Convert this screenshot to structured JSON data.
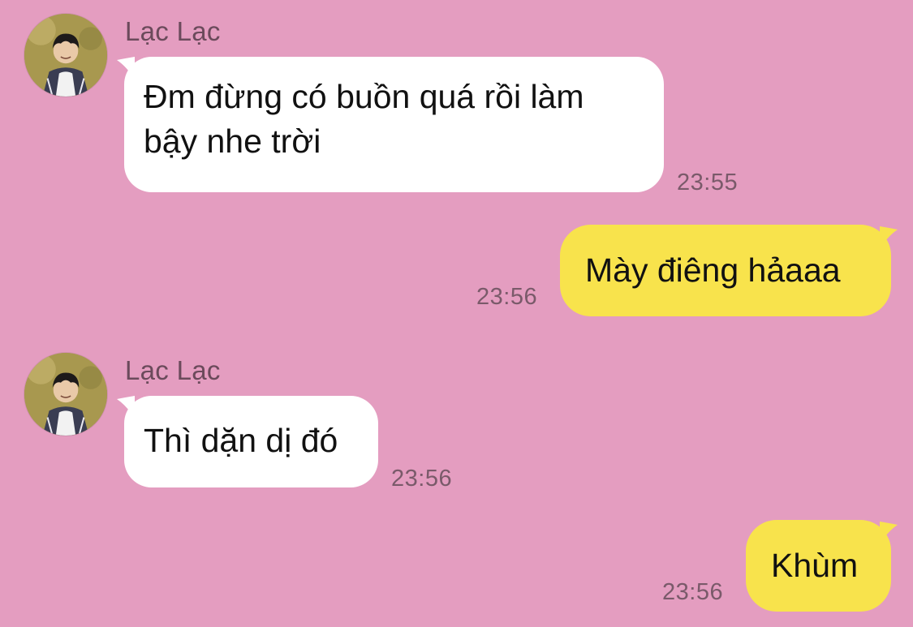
{
  "colors": {
    "background": "#e49dc0",
    "incoming_bubble": "#ffffff",
    "outgoing_bubble": "#f8e34c",
    "name_text": "#6b4a5b",
    "time_text": "#7a5a6a"
  },
  "messages": [
    {
      "direction": "incoming",
      "sender": "Lạc Lạc",
      "avatar": "contact-avatar",
      "lines": [
        "Đm đừng có buồn quá rồi làm",
        "bậy nhe trời"
      ],
      "time": "23:55"
    },
    {
      "direction": "outgoing",
      "lines": [
        "Mày điêng hảaaa"
      ],
      "time": "23:56"
    },
    {
      "direction": "incoming",
      "sender": "Lạc Lạc",
      "avatar": "contact-avatar",
      "lines": [
        "Thì dặn dị đó"
      ],
      "time": "23:56"
    },
    {
      "direction": "outgoing",
      "lines": [
        "Khùm"
      ],
      "time": "23:56"
    }
  ]
}
